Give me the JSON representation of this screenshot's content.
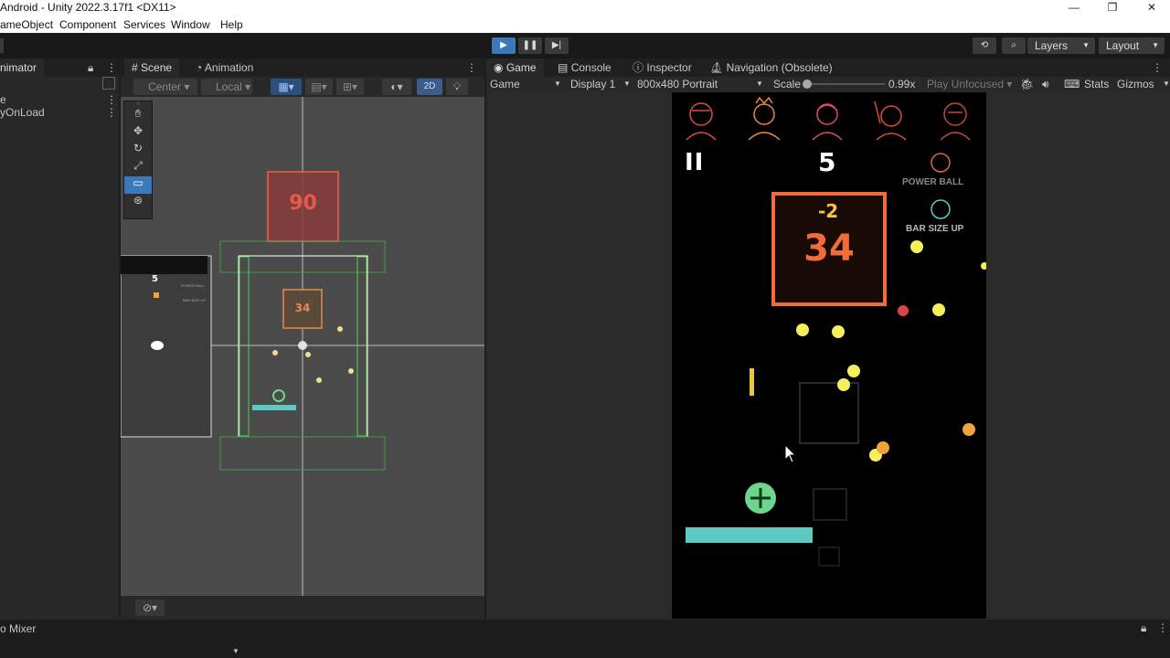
{
  "window": {
    "title": "Android - Unity 2022.3.17f1 <DX11>",
    "minimize": "—",
    "maximize": "❐",
    "close": "✕"
  },
  "menu": {
    "gameobject": "ameObject",
    "component": "Component",
    "services": "Services",
    "window": "Window",
    "help": "Help"
  },
  "toolbar": {
    "play": "▶",
    "pause": "❚❚",
    "step": "▶|",
    "layers": "Layers",
    "layout": "Layout"
  },
  "hierarchy": {
    "tab": "nimator",
    "row1": "e",
    "row2": "yOnLoad"
  },
  "scene": {
    "tabs": [
      "Scene",
      "Animation"
    ],
    "pivot": "Center",
    "space": "Local",
    "mode_2d": "2D",
    "block_top_value": "90",
    "block_mid_value": "34",
    "mini_score": "5",
    "mini_power": "POWER BALL",
    "mini_bar": "BAR SIZE UP"
  },
  "game": {
    "tabs": [
      "Game",
      "Console",
      "Inspector",
      "Navigation (Obsolete)"
    ],
    "display_mode": "Game",
    "display": "Display 1",
    "resolution": "800x480 Portrait",
    "scale_label": "Scale",
    "scale_value": "0.99x",
    "play_mode": "Play Unfocused",
    "stats": "Stats",
    "gizmos": "Gizmos",
    "hud": {
      "pause": "II",
      "score": "5",
      "power_ball": "POWER BALL",
      "bar_size_up": "BAR SIZE UP"
    },
    "block_value": "34",
    "block_hit": "-2",
    "colors": {
      "block": "#f26b3a",
      "ball": "#f5f05a",
      "paddle": "#5cc9c2",
      "powerup": "#6dd58c"
    }
  },
  "bottom": {
    "audio_mixer": "o Mixer"
  }
}
